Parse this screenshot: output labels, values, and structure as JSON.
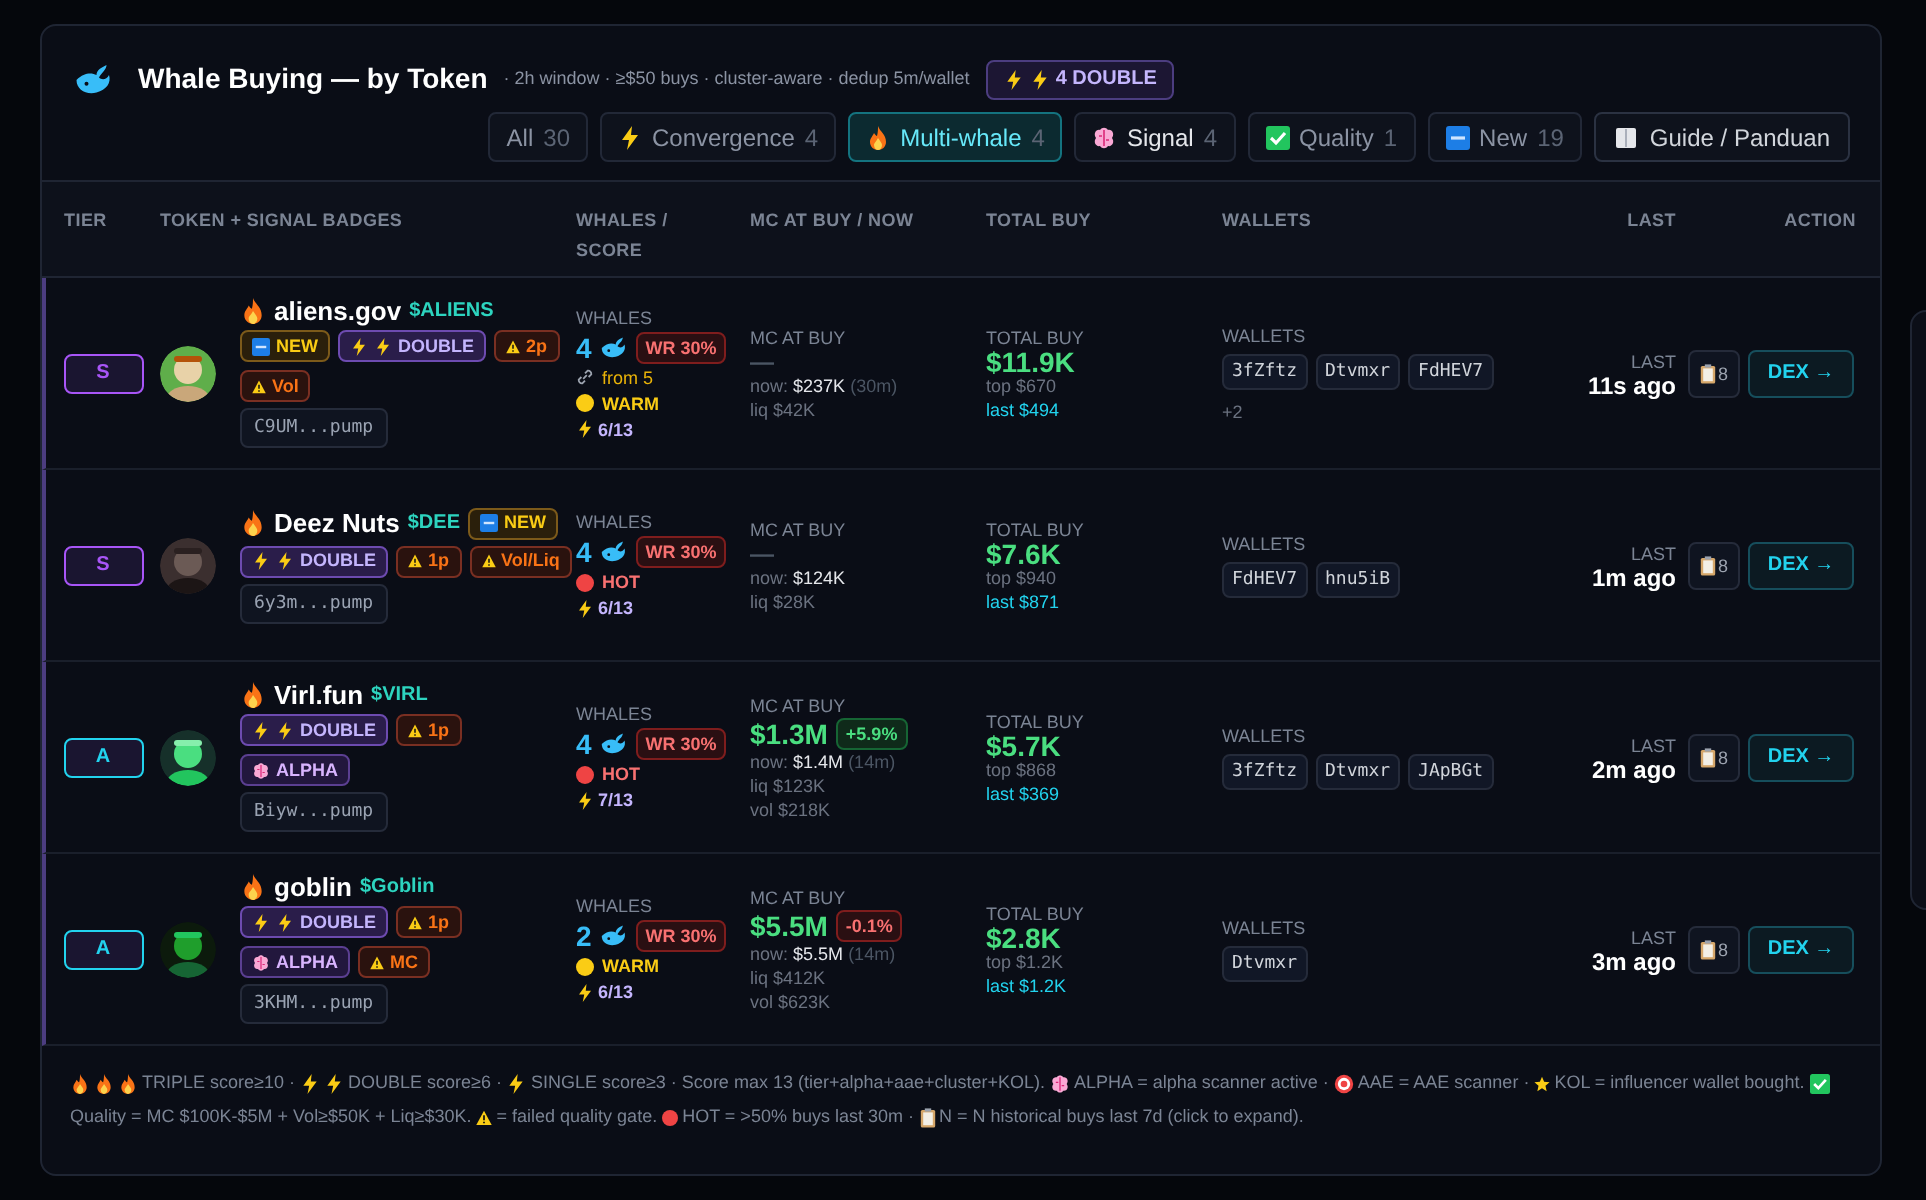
{
  "header": {
    "title": "Whale Buying — by Token",
    "subtitle": "· 2h window · ≥$50 buys · cluster-aware · dedup 5m/wallet",
    "badge": {
      "kind": "double",
      "label": "4 DOUBLE"
    }
  },
  "filters": [
    {
      "kind": "all",
      "label": "All",
      "count": "30",
      "selected": false
    },
    {
      "kind": "convergence",
      "label": "Convergence",
      "count": "4",
      "selected": false
    },
    {
      "kind": "multi",
      "label": "Multi-whale",
      "count": "4",
      "selected": true
    },
    {
      "kind": "signal",
      "label": "Signal",
      "count": "4",
      "selected": false
    },
    {
      "kind": "quality",
      "label": "Quality",
      "count": "1",
      "selected": false
    },
    {
      "kind": "new",
      "label": "New",
      "count": "19",
      "selected": false
    }
  ],
  "guide_button": {
    "label": "Guide / Panduan"
  },
  "table": {
    "columns": [
      "TIER",
      "TOKEN + SIGNAL BADGES",
      "WHALES / SCORE",
      "MC AT BUY / NOW",
      "TOTAL BUY",
      "WALLETS",
      "LAST",
      "ACTION"
    ],
    "rows": [
      {
        "tier": {
          "label": "S",
          "color": "#a855f7"
        },
        "token": {
          "name": "aliens.gov",
          "symbol": "$ALIENS",
          "badges": [
            {
              "kind": "new",
              "label": "NEW"
            },
            {
              "kind": "double",
              "label": "DOUBLE"
            },
            {
              "kind": "warn",
              "label": "2p"
            },
            {
              "kind": "warn",
              "label": "Vol"
            }
          ],
          "address": "C9UM...pump"
        },
        "whales": {
          "label": "WHALES",
          "count": "4",
          "wr": "WR 30%",
          "from": "from 5",
          "heat": {
            "kind": "warm",
            "label": "WARM"
          },
          "score": "6/13"
        },
        "mc": {
          "label": "MC AT BUY",
          "value": "—",
          "now_label": "now:",
          "now_value": "$237K",
          "now_age": "(30m)",
          "liq": "liq $42K"
        },
        "total": {
          "label": "TOTAL BUY",
          "value": "$11.9K",
          "top": "top $670",
          "last": "last $494"
        },
        "wallets": {
          "label": "WALLETS",
          "chips": [
            "3fZftz",
            "Dtvmxr",
            "FdHEV7"
          ],
          "more": "+2"
        },
        "last": {
          "label": "LAST",
          "value": "11s ago"
        },
        "history": "8",
        "dex": "DEX →"
      },
      {
        "tier": {
          "label": "S",
          "color": "#a855f7"
        },
        "token": {
          "name": "Deez Nuts",
          "symbol": "$DEE",
          "title_badges": [
            {
              "kind": "new",
              "label": "NEW"
            }
          ],
          "badges": [
            {
              "kind": "double",
              "label": "DOUBLE"
            },
            {
              "kind": "warn",
              "label": "1p"
            },
            {
              "kind": "warn",
              "label": "Vol/Liq"
            }
          ],
          "address": "6y3m...pump"
        },
        "whales": {
          "label": "WHALES",
          "count": "4",
          "wr": "WR 30%",
          "heat": {
            "kind": "hot",
            "label": "HOT"
          },
          "score": "6/13"
        },
        "mc": {
          "label": "MC AT BUY",
          "value": "—",
          "now_label": "now:",
          "now_value": "$124K",
          "liq": "liq $28K"
        },
        "total": {
          "label": "TOTAL BUY",
          "value": "$7.6K",
          "top": "top $940",
          "last": "last $871"
        },
        "wallets": {
          "label": "WALLETS",
          "chips": [
            "FdHEV7",
            "hnu5iB"
          ]
        },
        "last": {
          "label": "LAST",
          "value": "1m ago"
        },
        "history": "8",
        "dex": "DEX →"
      },
      {
        "tier": {
          "label": "A",
          "color": "#22d3ee"
        },
        "token": {
          "name": "Virl.fun",
          "symbol": "$VIRL",
          "badges": [
            {
              "kind": "double",
              "label": "DOUBLE"
            },
            {
              "kind": "warn",
              "label": "1p"
            },
            {
              "kind": "alpha",
              "label": "ALPHA"
            }
          ],
          "address": "Biyw...pump"
        },
        "whales": {
          "label": "WHALES",
          "count": "4",
          "wr": "WR 30%",
          "heat": {
            "kind": "hot",
            "label": "HOT"
          },
          "score": "7/13"
        },
        "mc": {
          "label": "MC AT BUY",
          "value": "$1.3M",
          "change": {
            "kind": "up",
            "label": "+5.9%"
          },
          "now_label": "now:",
          "now_value": "$1.4M",
          "now_age": "(14m)",
          "liq": "liq $123K",
          "vol": "vol $218K"
        },
        "total": {
          "label": "TOTAL BUY",
          "value": "$5.7K",
          "top": "top $868",
          "last": "last $369"
        },
        "wallets": {
          "label": "WALLETS",
          "chips": [
            "3fZftz",
            "Dtvmxr",
            "JApBGt"
          ]
        },
        "last": {
          "label": "LAST",
          "value": "2m ago"
        },
        "history": "8",
        "dex": "DEX →"
      },
      {
        "tier": {
          "label": "A",
          "color": "#22d3ee"
        },
        "token": {
          "name": "goblin",
          "symbol": "$Goblin",
          "badges": [
            {
              "kind": "double",
              "label": "DOUBLE"
            },
            {
              "kind": "warn",
              "label": "1p"
            },
            {
              "kind": "alpha",
              "label": "ALPHA"
            },
            {
              "kind": "warn",
              "label": "MC"
            }
          ],
          "address": "3KHM...pump"
        },
        "whales": {
          "label": "WHALES",
          "count": "2",
          "wr": "WR 30%",
          "heat": {
            "kind": "warm",
            "label": "WARM"
          },
          "score": "6/13"
        },
        "mc": {
          "label": "MC AT BUY",
          "value": "$5.5M",
          "change": {
            "kind": "down",
            "label": "-0.1%"
          },
          "now_label": "now:",
          "now_value": "$5.5M",
          "now_age": "(14m)",
          "liq": "liq $412K",
          "vol": "vol $623K"
        },
        "total": {
          "label": "TOTAL BUY",
          "value": "$2.8K",
          "top": "top $1.2K",
          "last": "last $1.2K"
        },
        "wallets": {
          "label": "WALLETS",
          "chips": [
            "Dtvmxr"
          ]
        },
        "last": {
          "label": "LAST",
          "value": "3m ago"
        },
        "history": "8",
        "dex": "DEX →"
      }
    ]
  },
  "legend": [
    {
      "kind": "triple",
      "text": "TRIPLE score≥10 ·"
    },
    {
      "kind": "double",
      "text": "DOUBLE score≥6 ·"
    },
    {
      "kind": "single",
      "text": "SINGLE score≥3 · Score max 13 (tier+alpha+aae+cluster+KOL)."
    },
    {
      "kind": "alpha",
      "text": "ALPHA = alpha scanner active ·"
    },
    {
      "kind": "aae",
      "text": "AAE = AAE scanner ·"
    },
    {
      "kind": "kol",
      "text": "KOL = influencer wallet bought."
    },
    {
      "kind": "quality",
      "text": "Quality = MC $100K-$5M + Vol≥$50K + Liq≥$30K."
    },
    {
      "kind": "warn",
      "text": "= failed quality gate."
    },
    {
      "kind": "hot",
      "text": "HOT = >50% buys last 30m ·"
    },
    {
      "kind": "history",
      "text": "N = N historical buys last 7d (click to expand)."
    }
  ]
}
